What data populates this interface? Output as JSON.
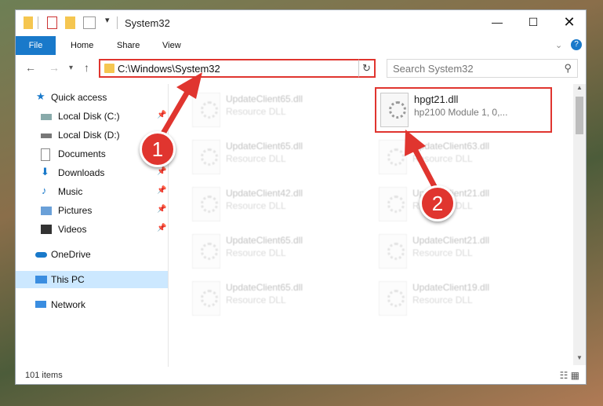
{
  "window": {
    "title": "System32"
  },
  "ribbon": {
    "tabs": [
      "File",
      "Home",
      "Share",
      "View"
    ]
  },
  "address": {
    "path": "C:\\Windows\\System32",
    "search_placeholder": "Search System32"
  },
  "nav": {
    "items": [
      {
        "label": "Quick access",
        "icon": "star-icon"
      },
      {
        "label": "Local Disk (C:)",
        "icon": "drive-icon",
        "pinned": true
      },
      {
        "label": "Local Disk (D:)",
        "icon": "drive-icon",
        "pinned": true
      },
      {
        "label": "Documents",
        "icon": "documents-icon",
        "pinned": true
      },
      {
        "label": "Downloads",
        "icon": "download-icon",
        "pinned": true
      },
      {
        "label": "Music",
        "icon": "music-icon",
        "pinned": true
      },
      {
        "label": "Pictures",
        "icon": "pictures-icon",
        "pinned": true
      },
      {
        "label": "Videos",
        "icon": "videos-icon",
        "pinned": true
      },
      {
        "label": "OneDrive",
        "icon": "cloud-icon"
      },
      {
        "label": "This PC",
        "icon": "computer-icon",
        "selected": true
      },
      {
        "label": "Network",
        "icon": "network-icon"
      }
    ]
  },
  "files": [
    {
      "name": "UpdateClient65.dll",
      "desc": "Resource DLL"
    },
    {
      "name": "hpgt21.dll",
      "desc": "hp2100 Module 1, 0,..."
    },
    {
      "name": "UpdateClient65.dll",
      "desc": "Resource DLL"
    },
    {
      "name": "UpdateClient63.dll",
      "desc": "Resource DLL"
    },
    {
      "name": "UpdateClient42.dll",
      "desc": "Resource DLL"
    },
    {
      "name": "UpdateClient21.dll",
      "desc": "Resource DLL"
    },
    {
      "name": "UpdateClient65.dll",
      "desc": "Resource DLL"
    },
    {
      "name": "UpdateClient21.dll",
      "desc": "Resource DLL"
    },
    {
      "name": "UpdateClient65.dll",
      "desc": "Resource DLL"
    },
    {
      "name": "UpdateClient19.dll",
      "desc": "Resource DLL"
    }
  ],
  "status": {
    "count": "101 items"
  },
  "annotations": {
    "badge1": "1",
    "badge2": "2",
    "accent": "#e0352f"
  }
}
